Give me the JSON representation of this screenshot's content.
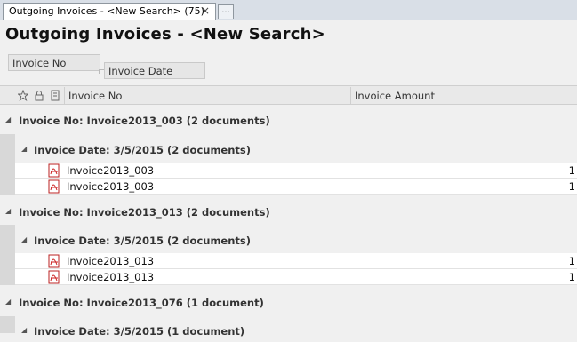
{
  "tab": {
    "label": "Outgoing Invoices - <New Search> (75)",
    "close": "×",
    "more": "..."
  },
  "page": {
    "title": "Outgoing Invoices - <New Search>"
  },
  "grouping": {
    "field1": "Invoice No",
    "field2": "Invoice Date"
  },
  "columns": {
    "invoice_no": "Invoice No",
    "invoice_amount": "Invoice Amount"
  },
  "icons": {
    "star": "star-icon",
    "lock": "lock-icon",
    "doc": "document-icon",
    "pdf": "pdf-file-icon",
    "expand": "collapse-triangle-icon"
  },
  "groups": [
    {
      "title": "Invoice No: Invoice2013_003 (2 documents)",
      "sub": {
        "title": "Invoice Date: 3/5/2015 (2 documents)",
        "rows": [
          {
            "name": "Invoice2013_003",
            "amount": "1"
          },
          {
            "name": "Invoice2013_003",
            "amount": "1"
          }
        ]
      }
    },
    {
      "title": "Invoice No: Invoice2013_013 (2 documents)",
      "sub": {
        "title": "Invoice Date: 3/5/2015 (2 documents)",
        "rows": [
          {
            "name": "Invoice2013_013",
            "amount": "1"
          },
          {
            "name": "Invoice2013_013",
            "amount": "1"
          }
        ]
      }
    },
    {
      "title": "Invoice No: Invoice2013_076 (1 document)",
      "sub": {
        "title": "Invoice Date: 3/5/2015 (1 document)",
        "rows": []
      }
    }
  ]
}
